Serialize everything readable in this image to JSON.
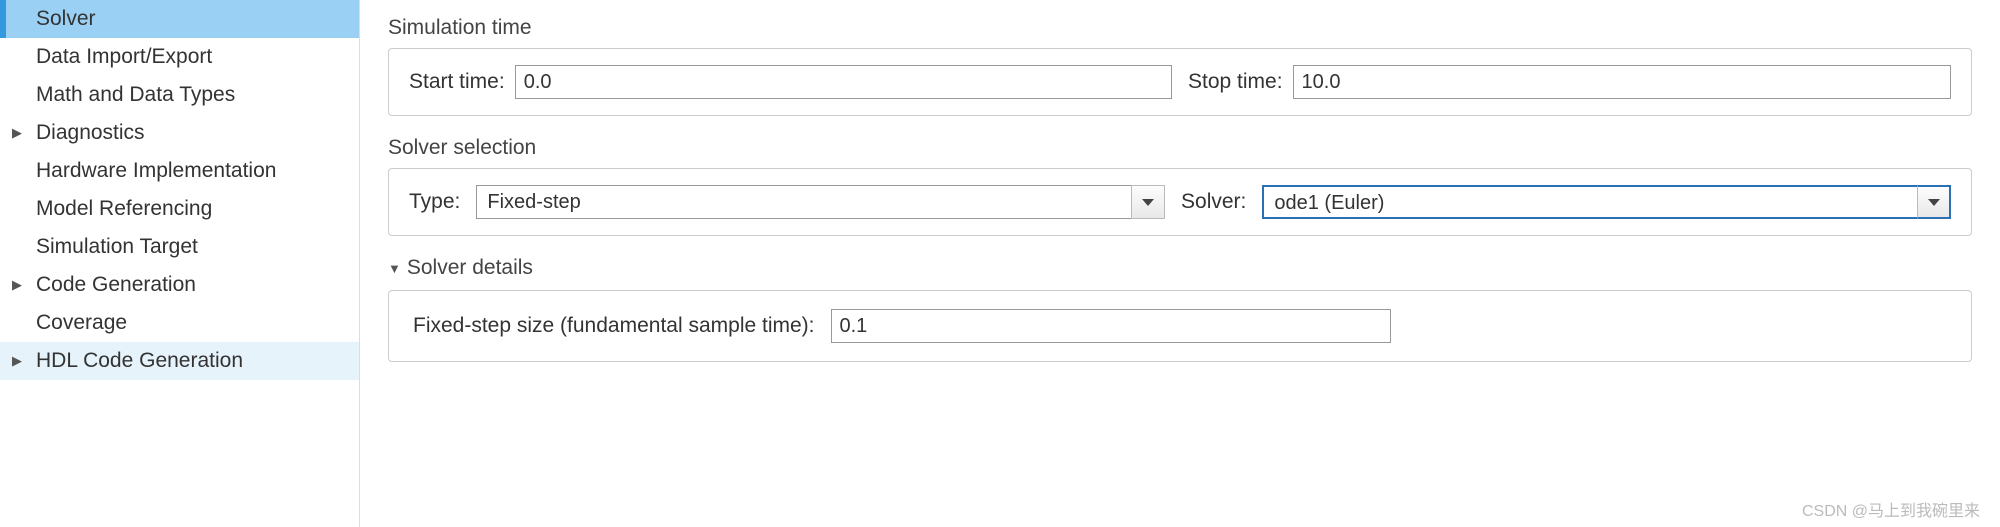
{
  "sidebar": {
    "items": [
      {
        "label": "Solver",
        "selected": true,
        "hasChildren": false
      },
      {
        "label": "Data Import/Export",
        "selected": false,
        "hasChildren": false
      },
      {
        "label": "Math and Data Types",
        "selected": false,
        "hasChildren": false
      },
      {
        "label": "Diagnostics",
        "selected": false,
        "hasChildren": true
      },
      {
        "label": "Hardware Implementation",
        "selected": false,
        "hasChildren": false
      },
      {
        "label": "Model Referencing",
        "selected": false,
        "hasChildren": false
      },
      {
        "label": "Simulation Target",
        "selected": false,
        "hasChildren": false
      },
      {
        "label": "Code Generation",
        "selected": false,
        "hasChildren": true
      },
      {
        "label": "Coverage",
        "selected": false,
        "hasChildren": false
      },
      {
        "label": "HDL Code Generation",
        "selected": false,
        "hasChildren": true,
        "hover": true
      }
    ]
  },
  "simulationTime": {
    "title": "Simulation time",
    "startLabel": "Start time:",
    "startValue": "0.0",
    "stopLabel": "Stop time:",
    "stopValue": "10.0"
  },
  "solverSelection": {
    "title": "Solver selection",
    "typeLabel": "Type:",
    "typeValue": "Fixed-step",
    "solverLabel": "Solver:",
    "solverValue": "ode1 (Euler)"
  },
  "solverDetails": {
    "title": "Solver details",
    "fixedStepLabel": "Fixed-step size (fundamental sample time):",
    "fixedStepValue": "0.1"
  },
  "watermark": "CSDN @马上到我碗里来"
}
